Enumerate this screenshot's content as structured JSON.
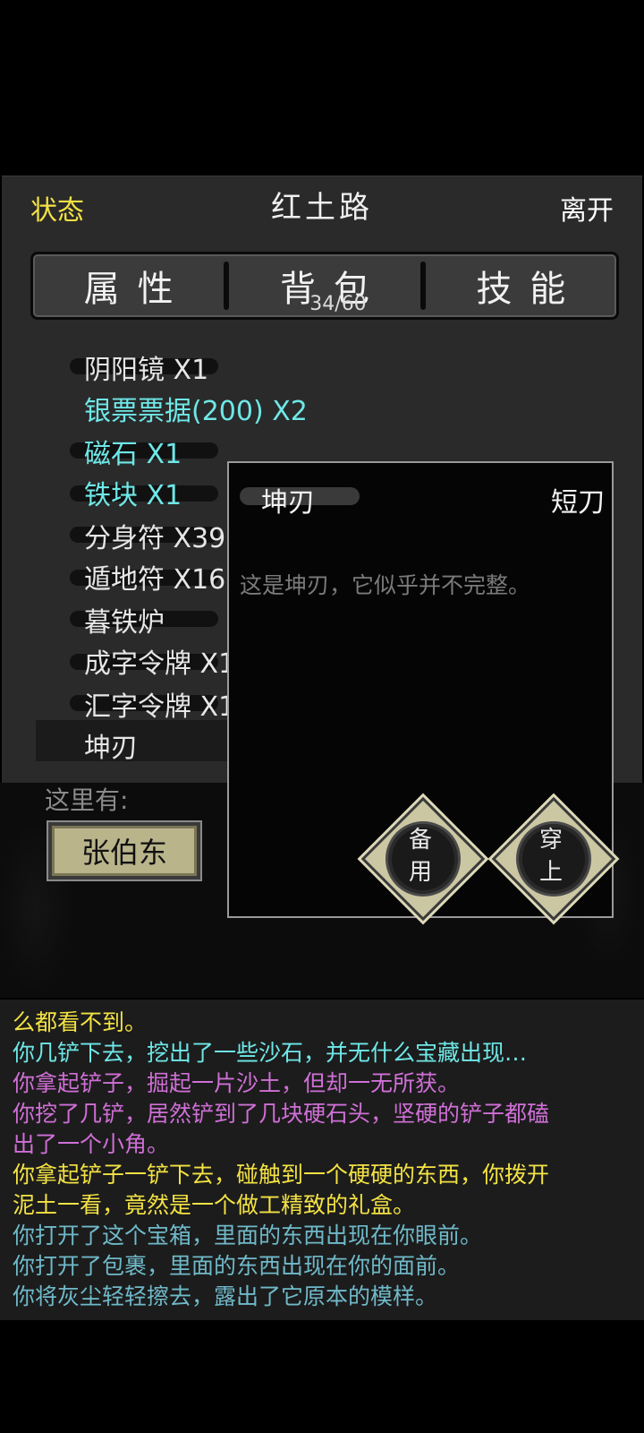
{
  "header": {
    "status": "状态",
    "title": "红土路",
    "leave": "离开"
  },
  "tabs": [
    {
      "label": "属性"
    },
    {
      "label": "背包",
      "count": "34/60"
    },
    {
      "label": "技能"
    }
  ],
  "inventory": [
    {
      "label": "阴阳镜 X1",
      "color": "#e6e6e6"
    },
    {
      "label": "银票票据(200) X2",
      "color": "#6fe7e7"
    },
    {
      "label": "磁石 X1",
      "color": "#6fe7e7"
    },
    {
      "label": "铁块 X1",
      "color": "#6fe7e7"
    },
    {
      "label": "分身符 X39",
      "color": "#e6e6e6"
    },
    {
      "label": "遁地符 X16",
      "color": "#e6e6e6"
    },
    {
      "label": "暮铁炉",
      "color": "#e6e6e6"
    },
    {
      "label": "成字令牌 X1",
      "color": "#e6e6e6"
    },
    {
      "label": "汇字令牌 X1",
      "color": "#e6e6e6"
    },
    {
      "label": "坤刃",
      "color": "#e6e6e6",
      "selected": true
    }
  ],
  "area": {
    "here_label": "这里有:",
    "npc": "张伯东"
  },
  "detail": {
    "name": "坤刃",
    "type": "短刀",
    "description": "这是坤刃，它似乎并不完整。",
    "reserve_button": [
      "备",
      "用"
    ],
    "equip_button": [
      "穿",
      "上"
    ]
  },
  "log": [
    {
      "text": "么都看不到。",
      "color": "#f3e243"
    },
    {
      "text": "你几铲下去，挖出了一些沙石，并无什么宝藏出现…",
      "color": "#6fe7e7"
    },
    {
      "text": "你拿起铲子，掘起一片沙土，但却一无所获。",
      "color": "#cf6fd6"
    },
    {
      "text": "你挖了几铲，居然铲到了几块硬石头，坚硬的铲子都磕",
      "color": "#cf6fd6"
    },
    {
      "text": "出了一个小角。",
      "color": "#cf6fd6"
    },
    {
      "text": "你拿起铲子一铲下去，碰触到一个硬硬的东西，你拨开",
      "color": "#f3e243"
    },
    {
      "text": "泥土一看，竟然是一个做工精致的礼盒。",
      "color": "#f3e243"
    },
    {
      "text": "你打开了这个宝箱，里面的东西出现在你眼前。",
      "color": "#6fb9c9"
    },
    {
      "text": "你打开了包裹，里面的东西出现在你的面前。",
      "color": "#6fb9c9"
    },
    {
      "text": "你将灰尘轻轻擦去，露出了它原本的模样。",
      "color": "#6fb9c9"
    }
  ]
}
